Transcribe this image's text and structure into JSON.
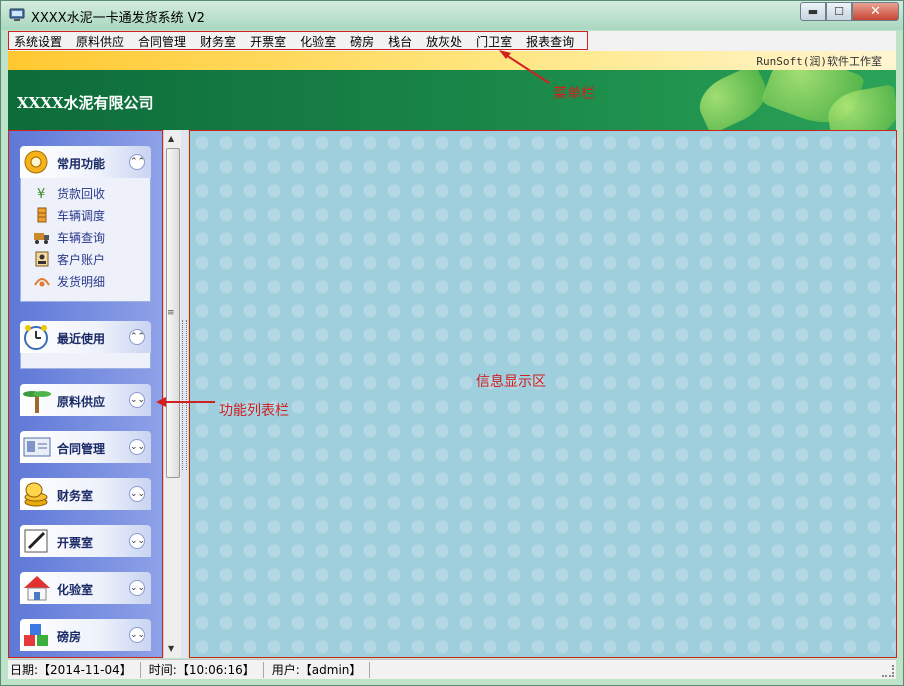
{
  "window": {
    "title": "XXXX水泥一卡通发货系统 V2",
    "minimize_label": "▬",
    "maximize_label": "☐",
    "close_label": "✕"
  },
  "menu": {
    "items": [
      "系统设置",
      "原料供应",
      "合同管理",
      "财务室",
      "开票室",
      "化验室",
      "磅房",
      "栈台",
      "放灰处",
      "门卫室",
      "报表查询"
    ]
  },
  "vendor": "RunSoft(润)软件工作室",
  "company": "XXXX水泥有限公司",
  "panel": {
    "groups": [
      {
        "name": "常用功能",
        "icon": "gear-icon",
        "chevron": "⌃⌃",
        "expanded": true,
        "items": [
          {
            "label": "货款回收",
            "icon": "yen-icon"
          },
          {
            "label": "车辆调度",
            "icon": "dispatch-icon"
          },
          {
            "label": "车辆查询",
            "icon": "truck-icon"
          },
          {
            "label": "客户账户",
            "icon": "account-icon"
          },
          {
            "label": "发货明细",
            "icon": "delivery-icon"
          }
        ]
      },
      {
        "name": "最近使用",
        "icon": "alarm-clock-icon",
        "chevron": "⌃⌃",
        "expanded": true,
        "items": []
      },
      {
        "name": "原料供应",
        "icon": "palm-tree-icon",
        "chevron": "⌄⌄",
        "expanded": false
      },
      {
        "name": "合同管理",
        "icon": "id-card-icon",
        "chevron": "⌄⌄",
        "expanded": false
      },
      {
        "name": "财务室",
        "icon": "coins-icon",
        "chevron": "⌄⌄",
        "expanded": false
      },
      {
        "name": "开票室",
        "icon": "pen-icon",
        "chevron": "⌄⌄",
        "expanded": false
      },
      {
        "name": "化验室",
        "icon": "house-icon",
        "chevron": "⌄⌄",
        "expanded": false
      },
      {
        "name": "磅房",
        "icon": "cubes-icon",
        "chevron": "⌄⌄",
        "expanded": false
      }
    ]
  },
  "info_area_label": "信息显示区",
  "annotations": {
    "menu_label": "菜单栏",
    "panel_label": "功能列表栏"
  },
  "status": {
    "date": "日期:【2014-11-04】",
    "time": "时间:【10:06:16】",
    "user": "用户:【admin】"
  },
  "colors": {
    "annotation_red": "#d02020",
    "banner_green": "#0d6b3a",
    "panel_blue": "#5e78d6",
    "info_bg": "#9fcedd"
  }
}
